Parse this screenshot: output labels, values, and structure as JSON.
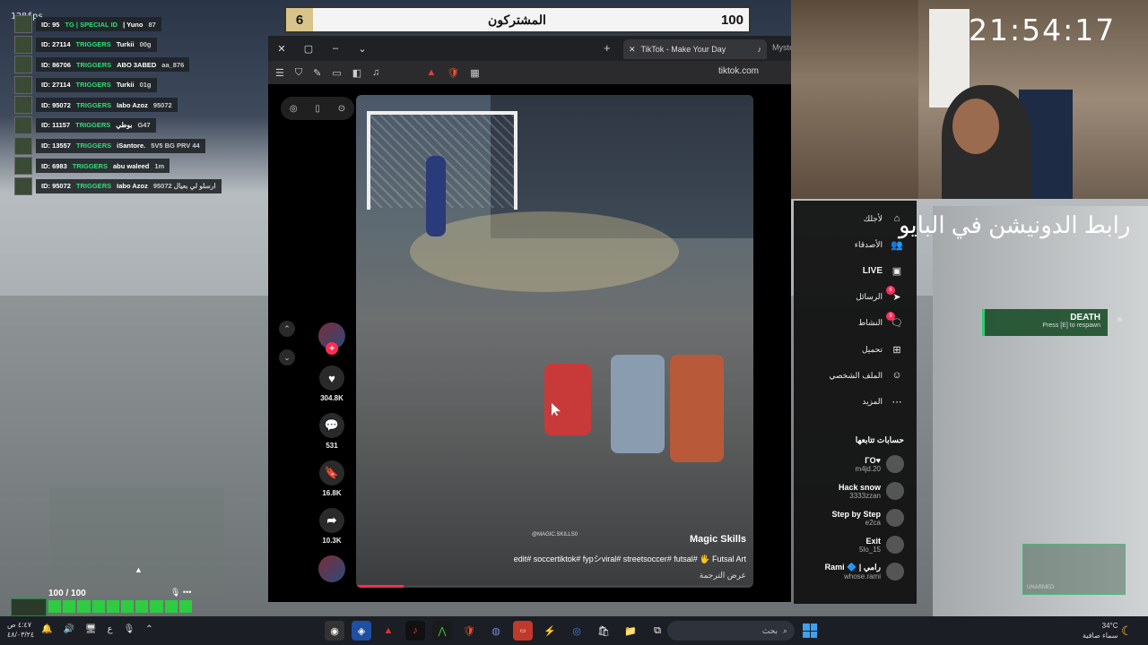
{
  "overlay": {
    "fps": "128fps",
    "subscribers_label": "المشتركون",
    "subscribers_left": "6",
    "subscribers_right": "100",
    "clock": "21:54:17",
    "donation_text": "رابط الدونيشن في البايو"
  },
  "killfeed": [
    {
      "killer": "ID: 95",
      "weapon": "TG | SPECIAL ID",
      "victim": "| Yuno",
      "extra": "87"
    },
    {
      "killer": "ID: 27114",
      "weapon": "TRIGGERS",
      "victim": "Turkii",
      "extra": "00g"
    },
    {
      "killer": "ID: 86706",
      "weapon": "TRIGGERS",
      "victim": "ABO 3ABED",
      "extra": "aa_876"
    },
    {
      "killer": "ID: 27114",
      "weapon": "TRIGGERS",
      "victim": "Turkii",
      "extra": "01g"
    },
    {
      "killer": "ID: 95072",
      "weapon": "TRIGGERS",
      "victim": "Iabo Azoz",
      "extra": "95072"
    },
    {
      "killer": "ID: 11157",
      "weapon": "TRIGGERS",
      "victim": "بوطي",
      "extra": "G47"
    },
    {
      "killer": "ID: 13557",
      "weapon": "TRIGGERS",
      "victim": "iSantore.",
      "extra": "5V5 BG PRV 44"
    },
    {
      "killer": "ID: 6983",
      "weapon": "TRIGGERS",
      "victim": "abu waleed",
      "extra": "1m"
    },
    {
      "killer": "ID: 95072",
      "weapon": "TRIGGERS",
      "victim": "Iabo Azoz",
      "extra": "95072 ارسلو لي بعيال"
    }
  ],
  "browser": {
    "tab_title": "TikTok - Make Your Day",
    "tab2_title": "Myste",
    "url": "tiktok.com"
  },
  "video": {
    "author": "Magic Skills",
    "hashtags": "edit# soccertiktok# fypシviral# streetsoccer# futsal# 🖐 Futsal Art",
    "translate": "عرض الترجمة",
    "watermark": "@MAGIC.SKILLS0",
    "progress": 0.12
  },
  "actions": {
    "likes": "304.8K",
    "comments": "531",
    "saves": "16.8K",
    "shares": "10.3K"
  },
  "sidebar": {
    "nav": [
      {
        "label": "لأجلك",
        "icon": "for-you-icon"
      },
      {
        "label": "الأصدقاء",
        "icon": "friends-icon"
      },
      {
        "label": "LIVE",
        "icon": "live-icon"
      },
      {
        "label": "الرسائل",
        "icon": "messages-icon",
        "badge": "6"
      },
      {
        "label": "النشاط",
        "icon": "activity-icon",
        "badge": "9"
      },
      {
        "label": "تحميل",
        "icon": "upload-icon"
      },
      {
        "label": "الملف الشخصي",
        "icon": "profile-icon"
      },
      {
        "label": "المزيد",
        "icon": "more-icon"
      }
    ],
    "following_header": "حسابات تتابعها",
    "accounts": [
      {
        "name": "ΓΟ♥",
        "handle": "m4jd.20"
      },
      {
        "name": "Hack snow",
        "handle": "3333zzan"
      },
      {
        "name": "Step by Step",
        "handle": "e2ca"
      },
      {
        "name": "Exit",
        "handle": "5lo_15"
      },
      {
        "name": "Rami 🔷 | رامي",
        "handle": "whose.rami"
      }
    ]
  },
  "game": {
    "death_title": "DEATH",
    "death_sub": "Press [E] to respawn",
    "hp": "100 / 100",
    "weapon_label": "UNARMED"
  },
  "taskbar": {
    "time": "٤:٤٧ ص",
    "date": "٤٨/٠٣/٢٤",
    "search_placeholder": "بحث",
    "temp": "34°C",
    "weather": "سماء صافية",
    "lang": "ع"
  }
}
